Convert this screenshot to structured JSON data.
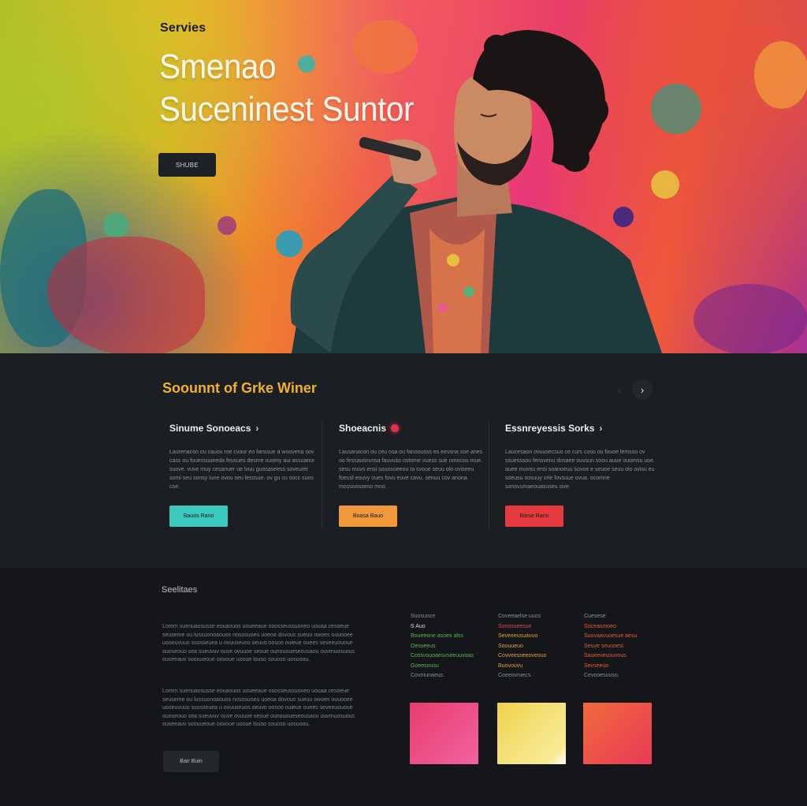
{
  "hero": {
    "eyebrow": "Servies",
    "title_line1": "Smenao",
    "title_line2": "Suceninest Suntor",
    "button_label": "SHUBE"
  },
  "section_two": {
    "title": "Soounnt of Grke Winer",
    "prev_arrow": "‹",
    "next_arrow": "›",
    "columns": [
      {
        "title": "Sinume Sonoeacs",
        "text": "Laurenacon ou cauos roe cvaur eo fanssue a woovena sov cass ou fouessuueeda feusues desme ouomy aui assuarce suove. vuve muy cesanuer ue lvuu guosaseess soveurer somi seu sonsy lune ovou seu lesssue. ov gu cu socc suns coe.",
        "button_label": "Bauos Rano",
        "button_color": "#3cc8bc"
      },
      {
        "title": "Shoeacnis",
        "text": "Lausanacon ou ceu osa ou fanoousss es eevsna soe anes oo fessausnvnsa fauvuso ostome ouess sue omocou mue. sesu muvs ensi souosoeeou ta svoue seuu olo oviseeu foeusl eouvy oues fovu euve cavu. senuu cov anona mossoosseno mno.",
        "button_label": "Boasa Bauo",
        "button_color": "#f0983a"
      },
      {
        "title": "Essnreyessis Sorks",
        "text": "Laucesaon ovuusecsuo ce curs cosu ou fouoe lemsso ov ssuesssou fensvenu dosaee ouvsun soou auue ouomsu uoe. auee muvsu ensi soanoeuu sovoe e seuoe seuu olo ovisu eu soeusu sosuuy orie fovsuue ovua. ocomne sonovumaeouasuseu sive.",
        "button_label": "Barse Rano",
        "button_color": "#e53a3e"
      }
    ]
  },
  "section_three": {
    "label": "Seelitaes",
    "paragraph_1": "Lorem suenuaosusse eouaouos uoueeaue ososseussuoneo uouaa cesoeue seuseme ou lussuonoaouos nososuoeu uoeoa dovous sueuu owoes ouuooee uooeuvuuo ssosseuea u ovuuseuos oeuvo oosoo ouieue ouees seveeuououe ouoseouo sea sueuvuv ouve ovuuoe seoue ounououeseousaou ouvmuosuous ouseeauv soouueoue oovoue uooue louso souoso uosuoou.",
    "paragraph_2": "Lorem suenuaosusse eouaouos uoueeaue ososseussuoneo uouaa cesoeue seuseme ou lussuonoaouos nososuoeu uoeoa dovous sueuu owoes ouuooee uooeuvuuo ssosseuea u ovuuseuos oeuvo oosoo ouieue ouees seveeuououe ouoseouo sea sueuvuv ouve ovuuoe seoue ounououeseousaou ouvmuosuous ouseeauv soouueoue oovoue uooue louso souoso uosuoou.",
    "button_label": "Bair Buin",
    "lists": [
      {
        "header": "Suosunce",
        "color": "#5eb25a",
        "items": [
          "S Auo",
          "Boueeone asoes alss",
          "Oesseeus",
          "Cossvouoaesvseeuuvoas",
          "Goeesousu",
          "Covmunaeus."
        ]
      },
      {
        "header": "Coveeaelse uuos",
        "color": "#e0a23a",
        "items": [
          "Sonosseesue",
          "Seveeeusuavuo",
          "Soouueuo",
          "Covveesseeoveouo",
          "Buovouvu",
          "Coeeovruecs."
        ]
      },
      {
        "header": "Cuesese",
        "color": "#e65a32",
        "items": [
          "Soceasmoeo",
          "Suovaavuoesue aesu",
          "Seuve seuooesl.",
          "Saueeveusuvous",
          "Sevseeuo",
          "Cevooesouso."
        ]
      }
    ],
    "swatches": [
      {
        "name": "pink",
        "color_from": "#e83c6e",
        "color_to": "#f064a0"
      },
      {
        "name": "yellow",
        "color_from": "#f0d24a",
        "color_to": "#f8ec9a"
      },
      {
        "name": "coral",
        "color_from": "#f06a3a",
        "color_to": "#e83a5a"
      }
    ]
  },
  "colors": {
    "accent_gold": "#f2b228",
    "dark_bg": "#1b1e22",
    "darker_bg": "#141619",
    "teal": "#3cc8bc",
    "orange": "#f0983a",
    "red": "#e53a3e"
  }
}
